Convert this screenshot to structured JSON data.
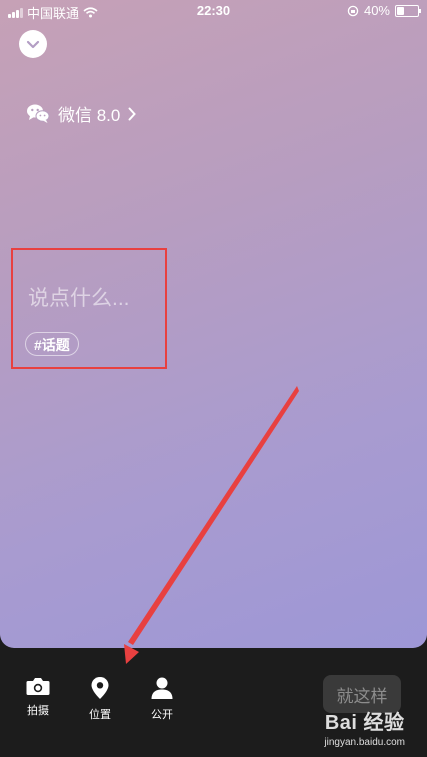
{
  "status_bar": {
    "carrier": "中国联通",
    "time": "22:30",
    "battery_percent": "40%",
    "battery_level": 0.4
  },
  "header": {
    "collapse_icon": "chevron-down-icon",
    "source_icon": "wechat-icon",
    "source_label": "微信 8.0",
    "source_chevron": "chevron-right-icon"
  },
  "editor": {
    "placeholder": "说点什么...",
    "topic_tag": "#话题"
  },
  "toolbar": {
    "items": [
      {
        "label": "拍摄",
        "icon": "camera-icon"
      },
      {
        "label": "位置",
        "icon": "location-pin-icon"
      },
      {
        "label": "公开",
        "icon": "person-icon"
      }
    ],
    "submit_label": "就这样"
  },
  "annotation": {
    "box_color": "#e84040",
    "arrow_color": "#e84040"
  },
  "watermark": {
    "logo": "Bai 经验",
    "url": "jingyan.baidu.com"
  },
  "colors": {
    "gradient_top": "#c6a1b6",
    "gradient_bottom": "#9d97d6",
    "toolbar_bg": "#1c1c1c"
  }
}
